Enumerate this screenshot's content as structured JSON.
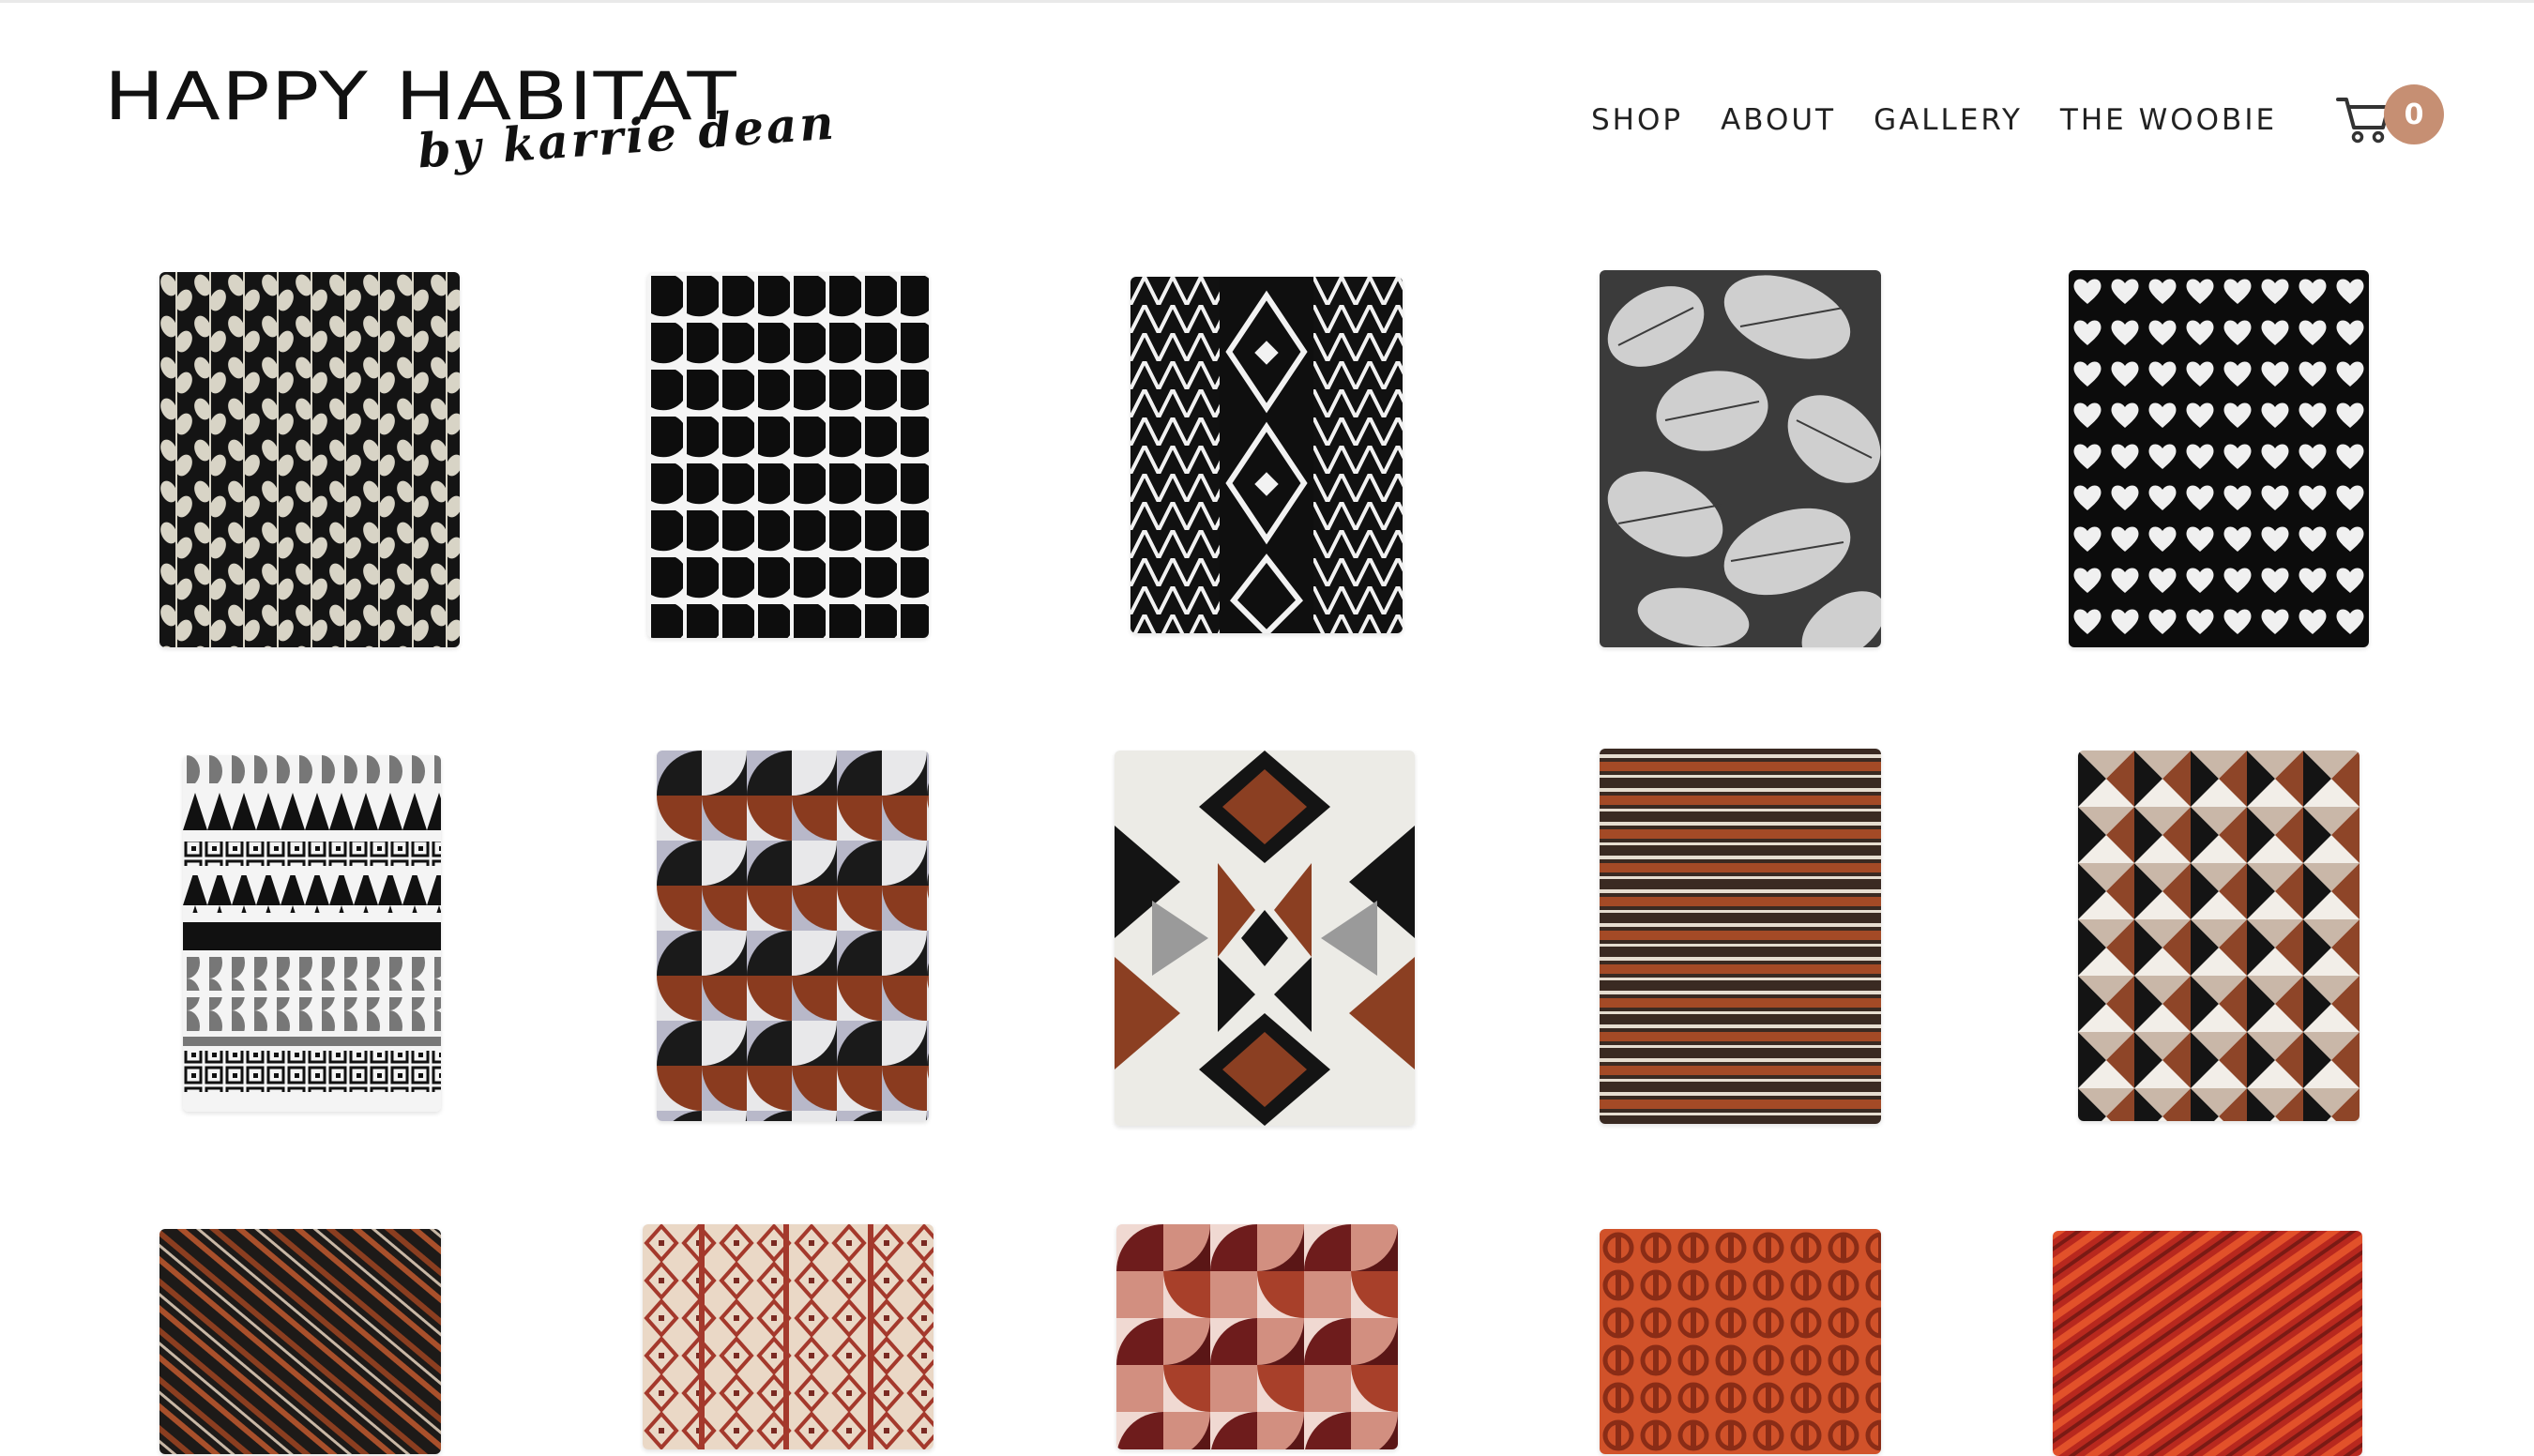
{
  "brand": {
    "name": "HAPPY HABITAT",
    "tagline": "by karrie dean"
  },
  "nav": {
    "items": [
      {
        "label": "SHOP"
      },
      {
        "label": "ABOUT"
      },
      {
        "label": "GALLERY"
      },
      {
        "label": "THE WOOBIE"
      }
    ]
  },
  "cart": {
    "icon": "cart-icon",
    "count": "0",
    "badge_color": "#c68f73"
  },
  "products": [
    {
      "pattern": "black-cream-leaf-vine"
    },
    {
      "pattern": "black-white-half-circles"
    },
    {
      "pattern": "black-white-tribal-diamond"
    },
    {
      "pattern": "gray-white-palm-leaves"
    },
    {
      "pattern": "black-white-hearts"
    },
    {
      "pattern": "black-gray-white-geometric-stripes"
    },
    {
      "pattern": "rust-gray-black-arches"
    },
    {
      "pattern": "rust-black-gray-southwest-aztec"
    },
    {
      "pattern": "brown-rust-cream-horizontal-stripes"
    },
    {
      "pattern": "rust-black-cream-triangles"
    },
    {
      "pattern": "black-rust-chevron-stripes"
    },
    {
      "pattern": "cream-rust-diamond-stripes"
    },
    {
      "pattern": "maroon-pink-cream-arches"
    },
    {
      "pattern": "orange-rust-circle-lattice"
    },
    {
      "pattern": "red-orange-diagonal-stripes"
    }
  ]
}
